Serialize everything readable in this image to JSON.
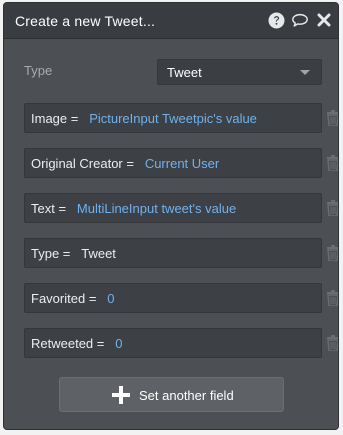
{
  "header": {
    "title": "Create a new Tweet...",
    "icons": [
      "help-icon",
      "comment-icon",
      "close-icon"
    ]
  },
  "type_selector": {
    "label": "Type",
    "value": "Tweet"
  },
  "fields": [
    {
      "key": "Image",
      "value": "PictureInput Tweetpic's value",
      "dynamic": true
    },
    {
      "key": "Original Creator",
      "value": "Current User",
      "dynamic": true
    },
    {
      "key": "Text",
      "value": "MultiLineInput tweet's value",
      "dynamic": true
    },
    {
      "key": "Type",
      "value": "Tweet",
      "dynamic": false
    },
    {
      "key": "Favorited",
      "value": "0",
      "dynamic": true
    },
    {
      "key": "Retweeted",
      "value": "0",
      "dynamic": true
    }
  ],
  "add_button": {
    "label": "Set another field"
  },
  "colors": {
    "panel_bg": "#4c5054",
    "header_bg": "#393c40",
    "field_bg": "#3d4044",
    "dynamic_value": "#6fb2ee",
    "button_bg": "#5e6266"
  }
}
